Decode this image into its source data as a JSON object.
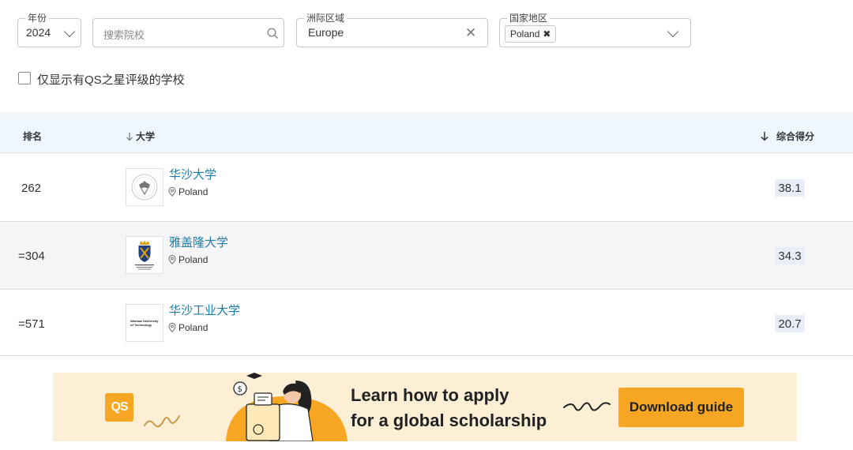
{
  "filters": {
    "year": {
      "legend": "年份",
      "value": "2024"
    },
    "search": {
      "placeholder": "搜索院校"
    },
    "region": {
      "legend": "洲际区域",
      "value": "Europe"
    },
    "country": {
      "legend": "国家地区",
      "chip": "Poland"
    }
  },
  "qs_stars_checkbox": {
    "label": "仅显示有QS之星评级的学校",
    "checked": false
  },
  "table": {
    "headers": {
      "rank": "排名",
      "university": "大学",
      "score": "综合得分"
    },
    "rows": [
      {
        "rank": "262",
        "name": "华沙大学",
        "country": "Poland",
        "score": "38.1"
      },
      {
        "rank": "=304",
        "name": "雅盖隆大学",
        "country": "Poland",
        "score": "34.3"
      },
      {
        "rank": "=571",
        "name": "华沙工业大学",
        "country": "Poland",
        "score": "20.7",
        "logo_text": [
          "Warsaw University",
          "of Technology"
        ]
      }
    ]
  },
  "banner": {
    "logo": "QS",
    "line1": "Learn how to apply",
    "line2": "for a global scholarship",
    "button": "Download guide"
  },
  "colors": {
    "accent": "#f6a623",
    "link": "#1d7ba6",
    "header_bg": "#eef7fd",
    "banner_bg": "#fcefd6"
  }
}
